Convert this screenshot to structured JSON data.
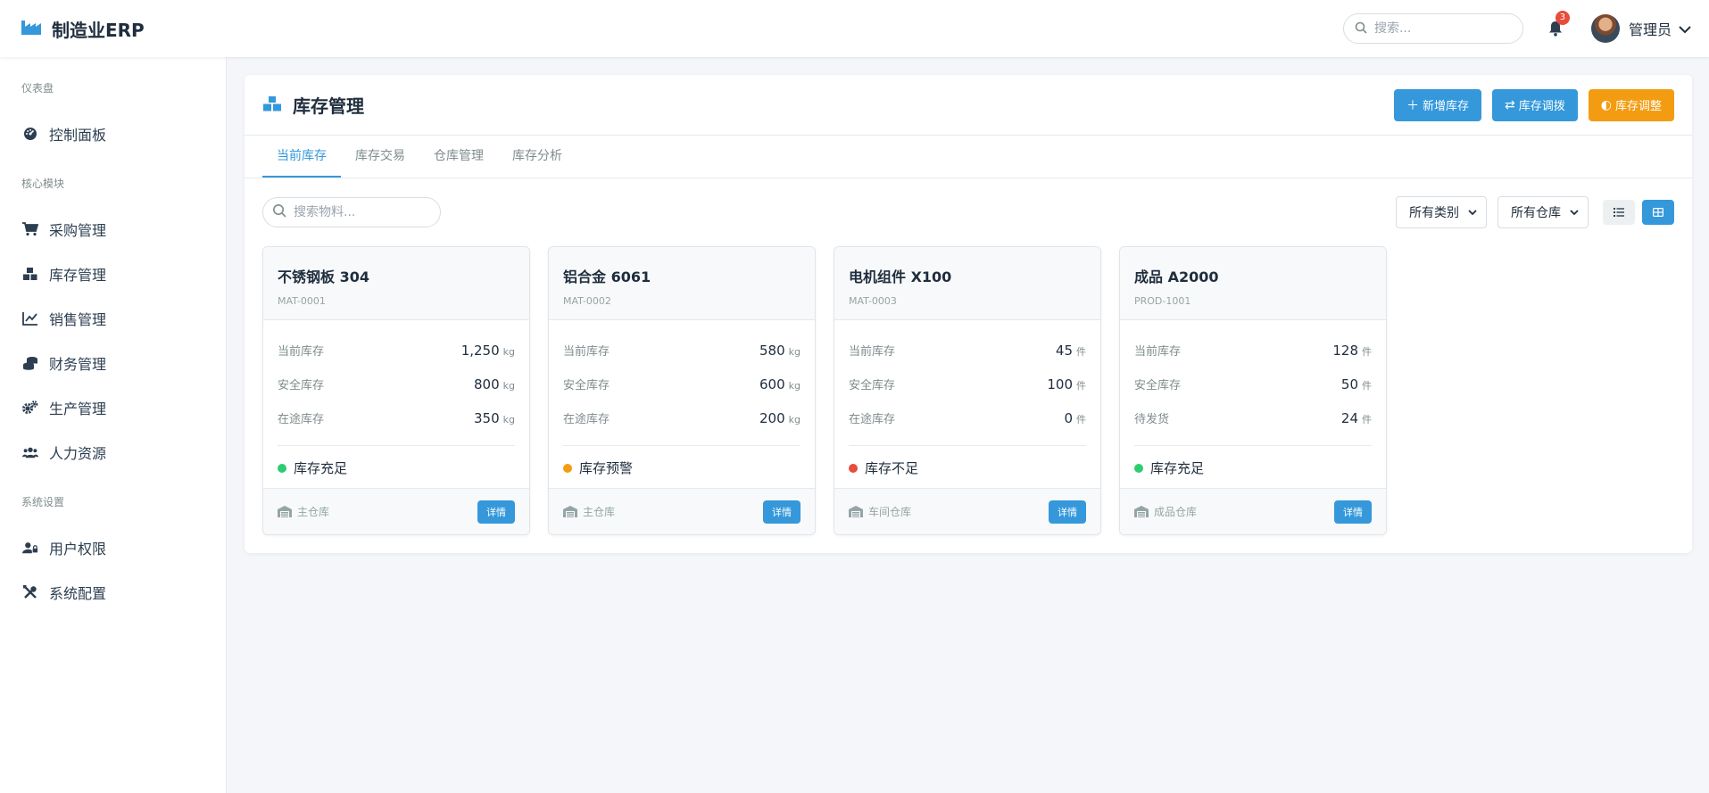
{
  "app": {
    "title": "制造业ERP"
  },
  "topbar": {
    "search_placeholder": "搜索...",
    "notification_count": "3",
    "user_name": "管理员"
  },
  "sidebar": {
    "sections": [
      {
        "title": "仪表盘",
        "items": [
          {
            "label": "控制面板",
            "icon": "dashboard-icon"
          }
        ]
      },
      {
        "title": "核心模块",
        "items": [
          {
            "label": "采购管理",
            "icon": "cart-icon"
          },
          {
            "label": "库存管理",
            "icon": "boxes-icon"
          },
          {
            "label": "销售管理",
            "icon": "chart-line-icon"
          },
          {
            "label": "财务管理",
            "icon": "coins-icon"
          },
          {
            "label": "生产管理",
            "icon": "gears-icon"
          },
          {
            "label": "人力资源",
            "icon": "users-icon"
          }
        ]
      },
      {
        "title": "系统设置",
        "items": [
          {
            "label": "用户权限",
            "icon": "user-lock-icon"
          },
          {
            "label": "系统配置",
            "icon": "tools-icon"
          }
        ]
      }
    ]
  },
  "page": {
    "title": "库存管理",
    "actions": {
      "add": "新增库存",
      "transfer": "库存调拨",
      "adjust": "库存调整"
    },
    "tabs": [
      "当前库存",
      "库存交易",
      "仓库管理",
      "库存分析"
    ],
    "search_placeholder": "搜索物料...",
    "filter_category": "所有类别",
    "filter_warehouse": "所有仓库"
  },
  "colors": {
    "accent": "#3498db",
    "ok": "#2ecc71",
    "warn": "#f39c12",
    "danger": "#e74c3c"
  },
  "items": [
    {
      "name": "不锈钢板 304",
      "code": "MAT-0001",
      "rows": [
        {
          "label": "当前库存",
          "value": "1,250",
          "unit": "kg"
        },
        {
          "label": "安全库存",
          "value": "800",
          "unit": "kg"
        },
        {
          "label": "在途库存",
          "value": "350",
          "unit": "kg"
        }
      ],
      "status": "库存充足",
      "status_color": "#2ecc71",
      "warehouse": "主仓库",
      "detail": "详情"
    },
    {
      "name": "铝合金 6061",
      "code": "MAT-0002",
      "rows": [
        {
          "label": "当前库存",
          "value": "580",
          "unit": "kg"
        },
        {
          "label": "安全库存",
          "value": "600",
          "unit": "kg"
        },
        {
          "label": "在途库存",
          "value": "200",
          "unit": "kg"
        }
      ],
      "status": "库存预警",
      "status_color": "#f39c12",
      "warehouse": "主仓库",
      "detail": "详情"
    },
    {
      "name": "电机组件 X100",
      "code": "MAT-0003",
      "rows": [
        {
          "label": "当前库存",
          "value": "45",
          "unit": "件"
        },
        {
          "label": "安全库存",
          "value": "100",
          "unit": "件"
        },
        {
          "label": "在途库存",
          "value": "0",
          "unit": "件"
        }
      ],
      "status": "库存不足",
      "status_color": "#e74c3c",
      "warehouse": "车间仓库",
      "detail": "详情"
    },
    {
      "name": "成品 A2000",
      "code": "PROD-1001",
      "rows": [
        {
          "label": "当前库存",
          "value": "128",
          "unit": "件"
        },
        {
          "label": "安全库存",
          "value": "50",
          "unit": "件"
        },
        {
          "label": "待发货",
          "value": "24",
          "unit": "件"
        }
      ],
      "status": "库存充足",
      "status_color": "#2ecc71",
      "warehouse": "成品仓库",
      "detail": "详情"
    }
  ]
}
